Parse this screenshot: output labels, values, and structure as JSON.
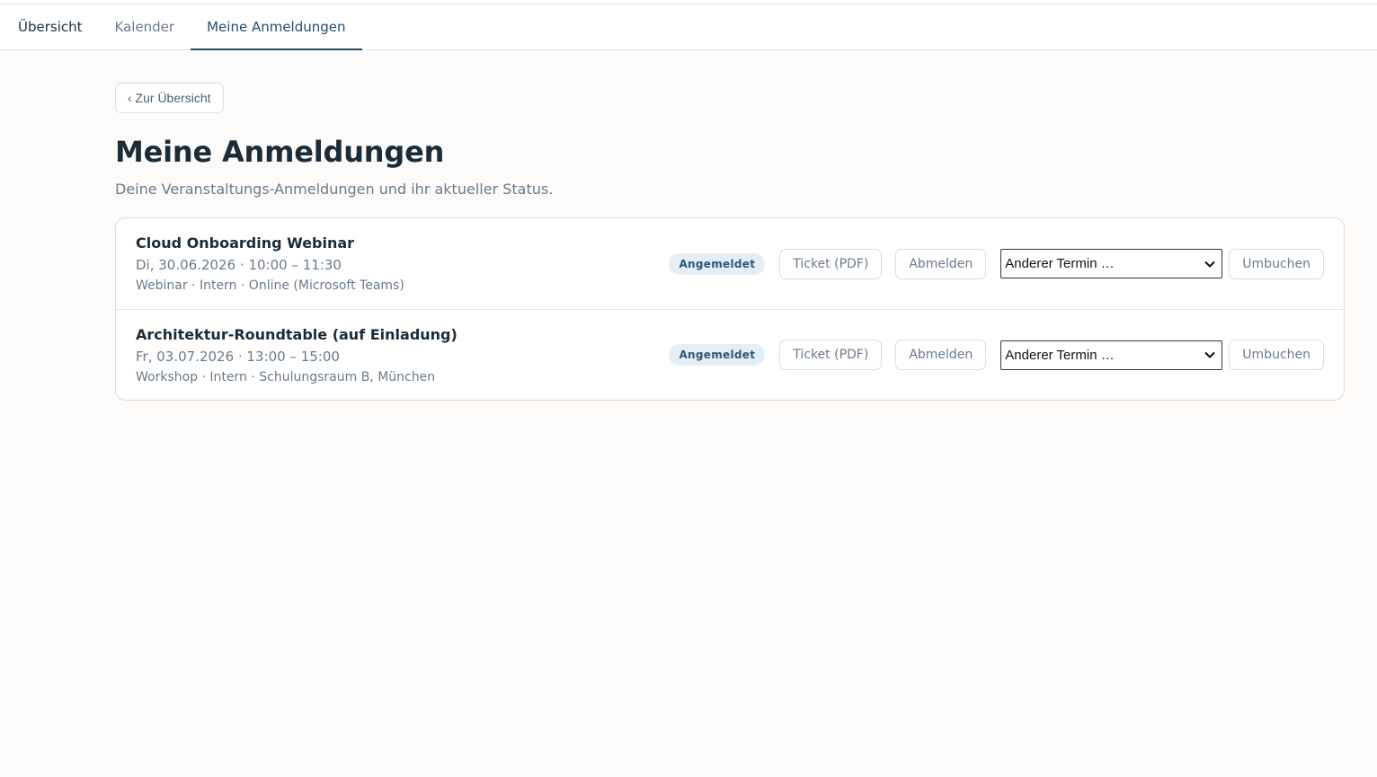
{
  "tabs": [
    {
      "label": "Übersicht"
    },
    {
      "label": "Kalender"
    },
    {
      "label": "Meine Anmeldungen"
    }
  ],
  "back_label": "‹ Zur Übersicht",
  "page_title": "Meine Anmeldungen",
  "page_subtitle": "Deine Veranstaltungs-Anmeldungen und ihr aktueller Status.",
  "registrations": [
    {
      "title": "Cloud Onboarding Webinar",
      "when": "Di, 30.06.2026 · 10:00 – 11:30",
      "meta": "Webinar · Intern · Online (Microsoft Teams)",
      "status": "Angemeldet",
      "ticket_label": "Ticket (PDF)",
      "cancel_label": "Abmelden",
      "select_value": "Anderer Termin …",
      "rebook_label": "Umbuchen"
    },
    {
      "title": "Architektur-Roundtable (auf Einladung)",
      "when": "Fr, 03.07.2026 · 13:00 – 15:00",
      "meta": "Workshop · Intern · Schulungsraum B, München",
      "status": "Angemeldet",
      "ticket_label": "Ticket (PDF)",
      "cancel_label": "Abmelden",
      "select_value": "Anderer Termin …",
      "rebook_label": "Umbuchen"
    }
  ],
  "colors": {
    "accent": "#234d6e",
    "badge_bg": "#e6eef5",
    "card_border": "#e6d8cf"
  }
}
